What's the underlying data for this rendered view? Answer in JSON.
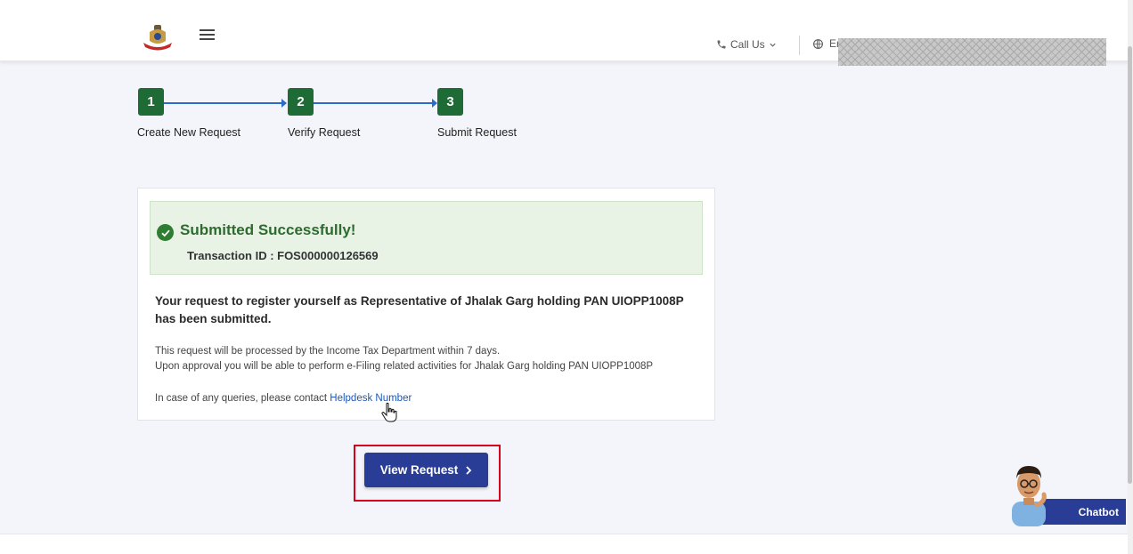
{
  "header": {
    "call_us_label": "Call Us",
    "language_label": "Er"
  },
  "stepper": {
    "steps": [
      {
        "number": "1",
        "label": "Create New Request"
      },
      {
        "number": "2",
        "label": "Verify Request"
      },
      {
        "number": "3",
        "label": "Submit Request"
      }
    ]
  },
  "status": {
    "title": "Submitted Successfully!",
    "transaction_id": "Transaction ID : FOS000000126569"
  },
  "message": {
    "main": "Your request to register yourself as Representative of Jhalak Garg holding PAN UIOPP1008P has been submitted.",
    "line1": "This request will be processed by the Income Tax Department within 7 days.",
    "line2": "Upon approval you will be able to perform e-Filing related activities for Jhalak Garg holding PAN UIOPP1008P",
    "contact_prefix": "In case of any queries, please contact ",
    "helpdesk_link": "Helpdesk Number"
  },
  "actions": {
    "view_request_label": "View Request"
  },
  "chatbot": {
    "label": "Chatbot"
  },
  "colors": {
    "step_green": "#1e6b36",
    "connector_blue": "#2d6bc9",
    "button_navy": "#293d96",
    "success_bg": "#e8f3e6",
    "highlight_red": "#d6001c"
  }
}
